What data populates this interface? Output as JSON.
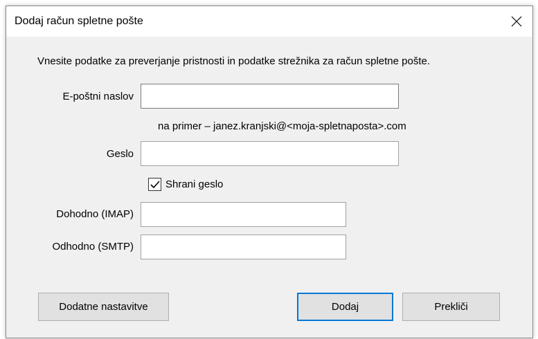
{
  "dialog": {
    "title": "Dodaj račun spletne pošte",
    "instruction": "Vnesite podatke za preverjanje pristnosti in podatke strežnika za račun spletne pošte.",
    "fields": {
      "email_label": "E-poštni naslov",
      "email_value": "",
      "email_hint": "na primer – janez.kranjski@<moja-spletnaposta>.com",
      "password_label": "Geslo",
      "password_value": "",
      "save_password_label": "Shrani geslo",
      "save_password_checked": true,
      "imap_label": "Dohodno (IMAP)",
      "imap_value": "",
      "smtp_label": "Odhodno (SMTP)",
      "smtp_value": ""
    },
    "buttons": {
      "advanced": "Dodatne nastavitve",
      "add": "Dodaj",
      "cancel": "Prekliči"
    },
    "accent_color": "#0078d7"
  }
}
